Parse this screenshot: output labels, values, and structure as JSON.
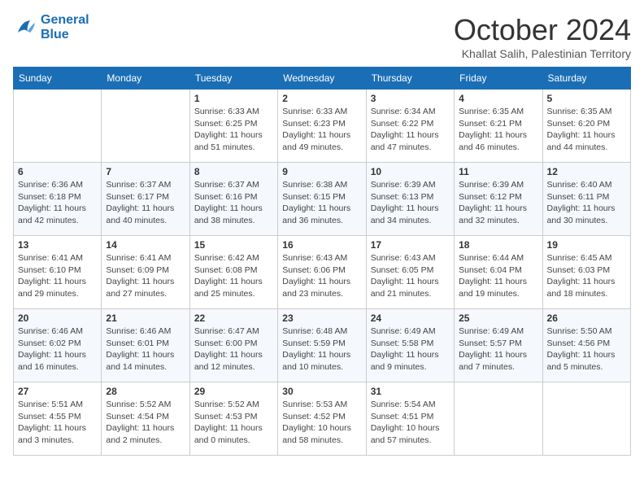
{
  "logo": {
    "line1": "General",
    "line2": "Blue"
  },
  "title": "October 2024",
  "location": "Khallat Salih, Palestinian Territory",
  "weekdays": [
    "Sunday",
    "Monday",
    "Tuesday",
    "Wednesday",
    "Thursday",
    "Friday",
    "Saturday"
  ],
  "weeks": [
    [
      {
        "day": "",
        "info": ""
      },
      {
        "day": "",
        "info": ""
      },
      {
        "day": "1",
        "info": "Sunrise: 6:33 AM\nSunset: 6:25 PM\nDaylight: 11 hours and 51 minutes."
      },
      {
        "day": "2",
        "info": "Sunrise: 6:33 AM\nSunset: 6:23 PM\nDaylight: 11 hours and 49 minutes."
      },
      {
        "day": "3",
        "info": "Sunrise: 6:34 AM\nSunset: 6:22 PM\nDaylight: 11 hours and 47 minutes."
      },
      {
        "day": "4",
        "info": "Sunrise: 6:35 AM\nSunset: 6:21 PM\nDaylight: 11 hours and 46 minutes."
      },
      {
        "day": "5",
        "info": "Sunrise: 6:35 AM\nSunset: 6:20 PM\nDaylight: 11 hours and 44 minutes."
      }
    ],
    [
      {
        "day": "6",
        "info": "Sunrise: 6:36 AM\nSunset: 6:18 PM\nDaylight: 11 hours and 42 minutes."
      },
      {
        "day": "7",
        "info": "Sunrise: 6:37 AM\nSunset: 6:17 PM\nDaylight: 11 hours and 40 minutes."
      },
      {
        "day": "8",
        "info": "Sunrise: 6:37 AM\nSunset: 6:16 PM\nDaylight: 11 hours and 38 minutes."
      },
      {
        "day": "9",
        "info": "Sunrise: 6:38 AM\nSunset: 6:15 PM\nDaylight: 11 hours and 36 minutes."
      },
      {
        "day": "10",
        "info": "Sunrise: 6:39 AM\nSunset: 6:13 PM\nDaylight: 11 hours and 34 minutes."
      },
      {
        "day": "11",
        "info": "Sunrise: 6:39 AM\nSunset: 6:12 PM\nDaylight: 11 hours and 32 minutes."
      },
      {
        "day": "12",
        "info": "Sunrise: 6:40 AM\nSunset: 6:11 PM\nDaylight: 11 hours and 30 minutes."
      }
    ],
    [
      {
        "day": "13",
        "info": "Sunrise: 6:41 AM\nSunset: 6:10 PM\nDaylight: 11 hours and 29 minutes."
      },
      {
        "day": "14",
        "info": "Sunrise: 6:41 AM\nSunset: 6:09 PM\nDaylight: 11 hours and 27 minutes."
      },
      {
        "day": "15",
        "info": "Sunrise: 6:42 AM\nSunset: 6:08 PM\nDaylight: 11 hours and 25 minutes."
      },
      {
        "day": "16",
        "info": "Sunrise: 6:43 AM\nSunset: 6:06 PM\nDaylight: 11 hours and 23 minutes."
      },
      {
        "day": "17",
        "info": "Sunrise: 6:43 AM\nSunset: 6:05 PM\nDaylight: 11 hours and 21 minutes."
      },
      {
        "day": "18",
        "info": "Sunrise: 6:44 AM\nSunset: 6:04 PM\nDaylight: 11 hours and 19 minutes."
      },
      {
        "day": "19",
        "info": "Sunrise: 6:45 AM\nSunset: 6:03 PM\nDaylight: 11 hours and 18 minutes."
      }
    ],
    [
      {
        "day": "20",
        "info": "Sunrise: 6:46 AM\nSunset: 6:02 PM\nDaylight: 11 hours and 16 minutes."
      },
      {
        "day": "21",
        "info": "Sunrise: 6:46 AM\nSunset: 6:01 PM\nDaylight: 11 hours and 14 minutes."
      },
      {
        "day": "22",
        "info": "Sunrise: 6:47 AM\nSunset: 6:00 PM\nDaylight: 11 hours and 12 minutes."
      },
      {
        "day": "23",
        "info": "Sunrise: 6:48 AM\nSunset: 5:59 PM\nDaylight: 11 hours and 10 minutes."
      },
      {
        "day": "24",
        "info": "Sunrise: 6:49 AM\nSunset: 5:58 PM\nDaylight: 11 hours and 9 minutes."
      },
      {
        "day": "25",
        "info": "Sunrise: 6:49 AM\nSunset: 5:57 PM\nDaylight: 11 hours and 7 minutes."
      },
      {
        "day": "26",
        "info": "Sunrise: 5:50 AM\nSunset: 4:56 PM\nDaylight: 11 hours and 5 minutes."
      }
    ],
    [
      {
        "day": "27",
        "info": "Sunrise: 5:51 AM\nSunset: 4:55 PM\nDaylight: 11 hours and 3 minutes."
      },
      {
        "day": "28",
        "info": "Sunrise: 5:52 AM\nSunset: 4:54 PM\nDaylight: 11 hours and 2 minutes."
      },
      {
        "day": "29",
        "info": "Sunrise: 5:52 AM\nSunset: 4:53 PM\nDaylight: 11 hours and 0 minutes."
      },
      {
        "day": "30",
        "info": "Sunrise: 5:53 AM\nSunset: 4:52 PM\nDaylight: 10 hours and 58 minutes."
      },
      {
        "day": "31",
        "info": "Sunrise: 5:54 AM\nSunset: 4:51 PM\nDaylight: 10 hours and 57 minutes."
      },
      {
        "day": "",
        "info": ""
      },
      {
        "day": "",
        "info": ""
      }
    ]
  ]
}
